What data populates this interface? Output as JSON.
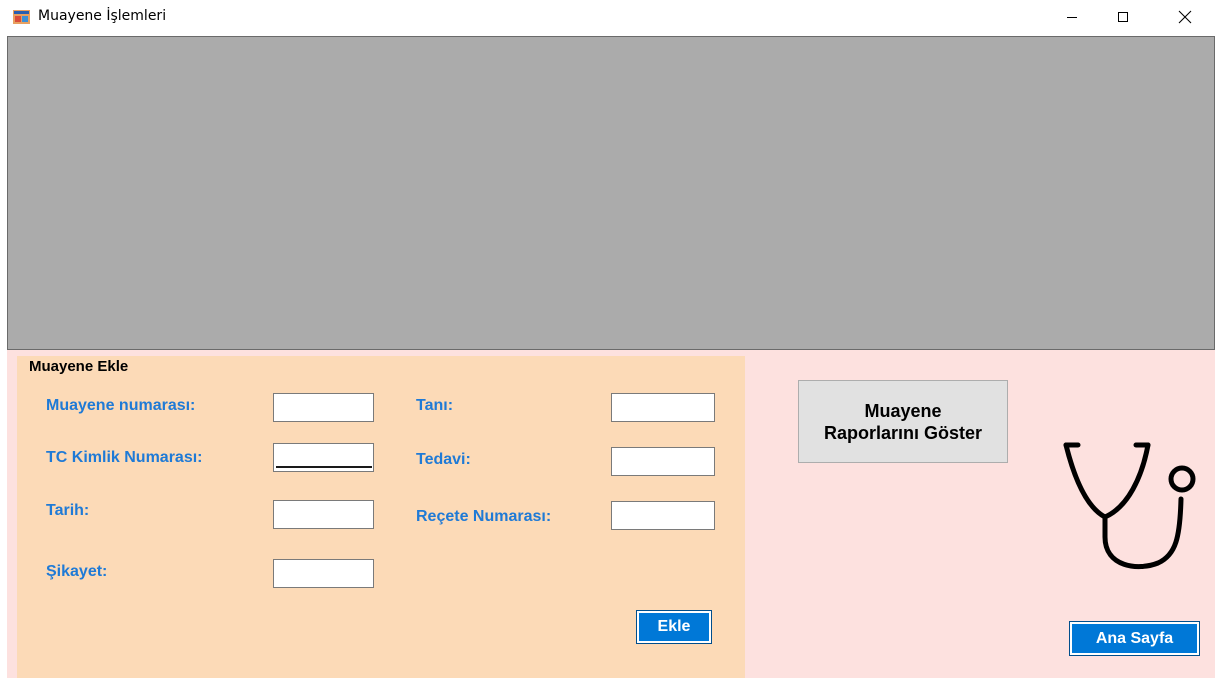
{
  "window": {
    "title": "Muayene İşlemleri",
    "controls": {
      "minimize": "minimize-icon",
      "maximize": "maximize-icon",
      "close": "close-icon"
    }
  },
  "form": {
    "group_title": "Muayene Ekle",
    "fields": {
      "muayene_no": {
        "label": "Muayene numarası:",
        "value": ""
      },
      "tc_kimlik": {
        "label": "TC Kimlik Numarası:",
        "value": ""
      },
      "tarih": {
        "label": "Tarih:",
        "value": ""
      },
      "sikayet": {
        "label": "Şikayet:",
        "value": ""
      },
      "tani": {
        "label": "Tanı:",
        "value": ""
      },
      "tedavi": {
        "label": "Tedavi:",
        "value": ""
      },
      "recete": {
        "label": "Reçete Numarası:",
        "value": ""
      }
    },
    "add_button": "Ekle"
  },
  "actions": {
    "show_reports_line1": "Muayene",
    "show_reports_line2": "Raporlarını Göster",
    "home_button": "Ana Sayfa"
  },
  "colors": {
    "grid_bg": "#ababab",
    "form_bg": "#fcdab7",
    "area_bg": "#fde1df",
    "label": "#1f7ad6",
    "accent_button": "#0078d7"
  },
  "icons": {
    "app": "form-app-icon",
    "decor": "stethoscope-icon"
  }
}
